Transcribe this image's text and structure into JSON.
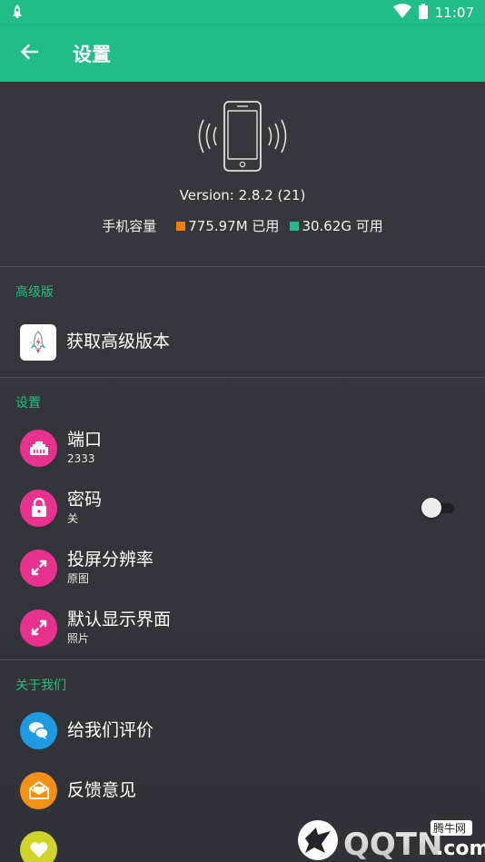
{
  "status_bar": {
    "time": "11:07",
    "app_icon": "rocket-icon",
    "wifi_icon": "wifi-icon",
    "battery_icon": "battery-icon"
  },
  "app_bar": {
    "title": "设置",
    "back_icon": "arrow-back-icon"
  },
  "device": {
    "version": "Version: 2.8.2 (21)",
    "storage_label": "手机容量",
    "used": "775.97M 已用",
    "free": "30.62G 可用",
    "used_color": "#f57c00",
    "free_color": "#20bd88"
  },
  "sections": {
    "premium": {
      "header": "高级版",
      "get_premium": "获取高级版本"
    },
    "settings": {
      "header": "设置",
      "port": {
        "title": "端口",
        "value": "2333"
      },
      "password": {
        "title": "密码",
        "value": "关",
        "toggle_on": false
      },
      "resolution": {
        "title": "投屏分辨率",
        "value": "原图"
      },
      "default_view": {
        "title": "默认显示界面",
        "value": "照片"
      }
    },
    "about": {
      "header": "关于我们",
      "rate": "给我们评价",
      "feedback": "反馈意见",
      "partial_item": ""
    }
  },
  "watermark": {
    "brand": "QQTN",
    "domain": ".com",
    "cn_name": "腾牛网"
  },
  "colors": {
    "accent": "#20bd88",
    "icon_pink": "#e8328e",
    "icon_blue": "#1e9be0",
    "icon_orange": "#f39016",
    "icon_yellow": "#cfd32a"
  }
}
